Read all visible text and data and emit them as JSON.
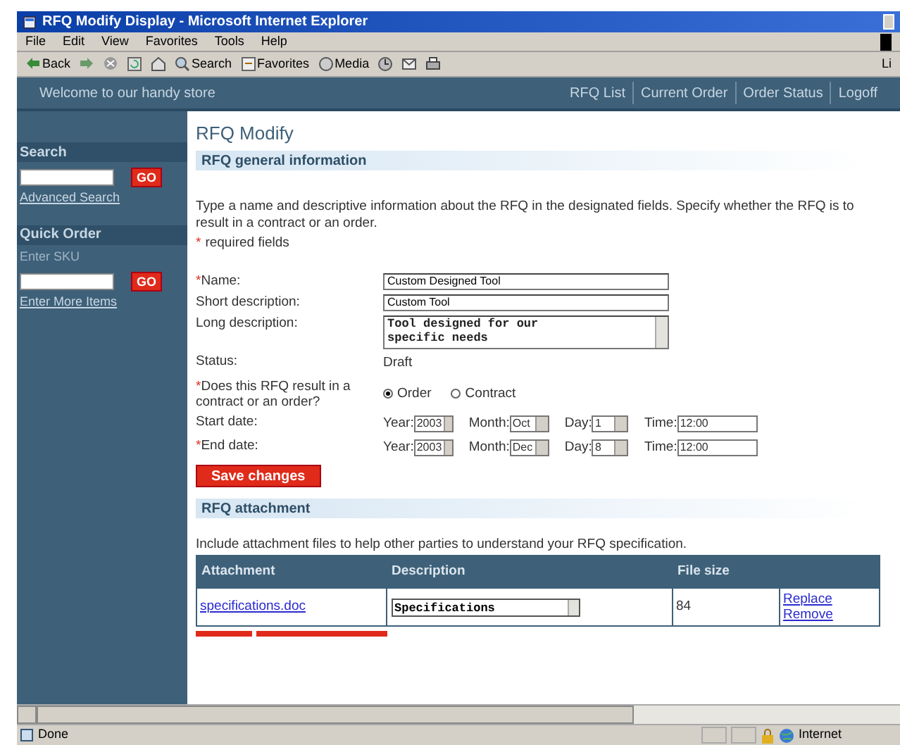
{
  "window": {
    "title": "RFQ Modify Display - Microsoft Internet Explorer"
  },
  "menu": [
    "File",
    "Edit",
    "View",
    "Favorites",
    "Tools",
    "Help"
  ],
  "toolbar": [
    {
      "kind": "back",
      "label": "Back"
    },
    {
      "kind": "forward"
    },
    {
      "kind": "stop"
    },
    {
      "kind": "refresh"
    },
    {
      "kind": "home"
    },
    {
      "kind": "search",
      "label": "Search"
    },
    {
      "kind": "favorites",
      "label": "Favorites"
    },
    {
      "kind": "media",
      "label": "Media"
    },
    {
      "kind": "history"
    },
    {
      "kind": "mail"
    },
    {
      "kind": "print"
    }
  ],
  "links_label": "Li",
  "header": {
    "welcome": "Welcome to our handy store",
    "nav": [
      "RFQ List",
      "Current Order",
      "Order Status",
      "Logoff"
    ]
  },
  "sidebar": {
    "search_title": "Search",
    "go": "GO",
    "advanced": "Advanced Search",
    "order_title": "Quick Order",
    "sku_label": "Enter SKU",
    "go2": "GO",
    "more": "Enter More Items"
  },
  "page_title": "RFQ Modify",
  "general": {
    "title": "RFQ general information",
    "intro": "Type a name and descriptive information about the RFQ in the designated fields. Specify whether the RFQ is to result in a contract or an order.",
    "required_note": "required fields",
    "required_mark": "*",
    "fields": [
      {
        "kind": "text",
        "mark": "*",
        "label": "Name:",
        "value": "Custom Designed Tool"
      },
      {
        "kind": "text",
        "label": "Short description:",
        "value": "Custom Tool"
      },
      {
        "kind": "textarea",
        "label": "Long description:",
        "value": "Tool designed for our specific needs"
      },
      {
        "kind": "static",
        "label": "Status:",
        "value": "Draft"
      },
      {
        "kind": "radio",
        "mark": "*",
        "label": "Does this RFQ result in a contract or an order?",
        "options": [
          {
            "label": "Order",
            "selected": true
          },
          {
            "label": "Contract",
            "selected": false
          }
        ]
      },
      {
        "kind": "date",
        "label": "Start date:",
        "year_label": "Year:",
        "year": "2003",
        "month_label": "Month:",
        "month": "Oct",
        "day_label": "Day:",
        "day": "1",
        "time_label": "Time:",
        "time": "12:00"
      },
      {
        "kind": "date",
        "mark": "*",
        "label": "End date:",
        "year_label": "Year:",
        "year": "2003",
        "month_label": "Month:",
        "month": "Dec",
        "day_label": "Day:",
        "day": "8",
        "time_label": "Time:",
        "time": "12:00"
      }
    ],
    "save": "Save changes"
  },
  "attachment": {
    "title": "RFQ attachment",
    "intro": "Include attachment files to help other parties to understand your RFQ specification.",
    "columns": [
      "Attachment",
      "Description",
      "File size"
    ],
    "rows": [
      {
        "file": "specifications.doc",
        "description": "Specifications",
        "size": "84",
        "actions": [
          "Replace",
          "Remove"
        ]
      }
    ]
  },
  "status_bar": {
    "text": "Done",
    "zone": "Internet"
  }
}
